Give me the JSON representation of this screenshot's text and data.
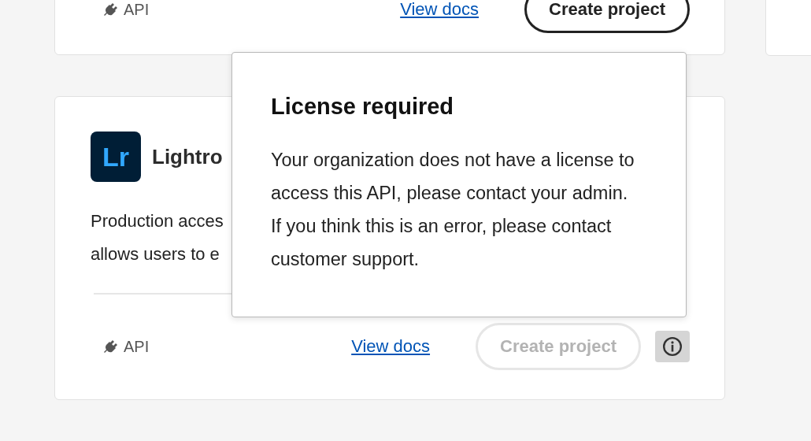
{
  "cards": [
    {
      "footer": {
        "api_label": "API",
        "docs_link": "View docs",
        "create_button": {
          "label": "Create project",
          "disabled": false
        }
      }
    },
    {
      "logo": "Lr",
      "title": "Lightro",
      "description": [
        "Production acces",
        "allows users to e"
      ],
      "footer": {
        "api_label": "API",
        "docs_link": "View docs",
        "create_button": {
          "label": "Create project",
          "disabled": true
        }
      }
    }
  ],
  "popover": {
    "title": "License required",
    "text": "Your organization does not have a license to access this API, please contact your admin. If you think this is an error, please contact customer support."
  }
}
